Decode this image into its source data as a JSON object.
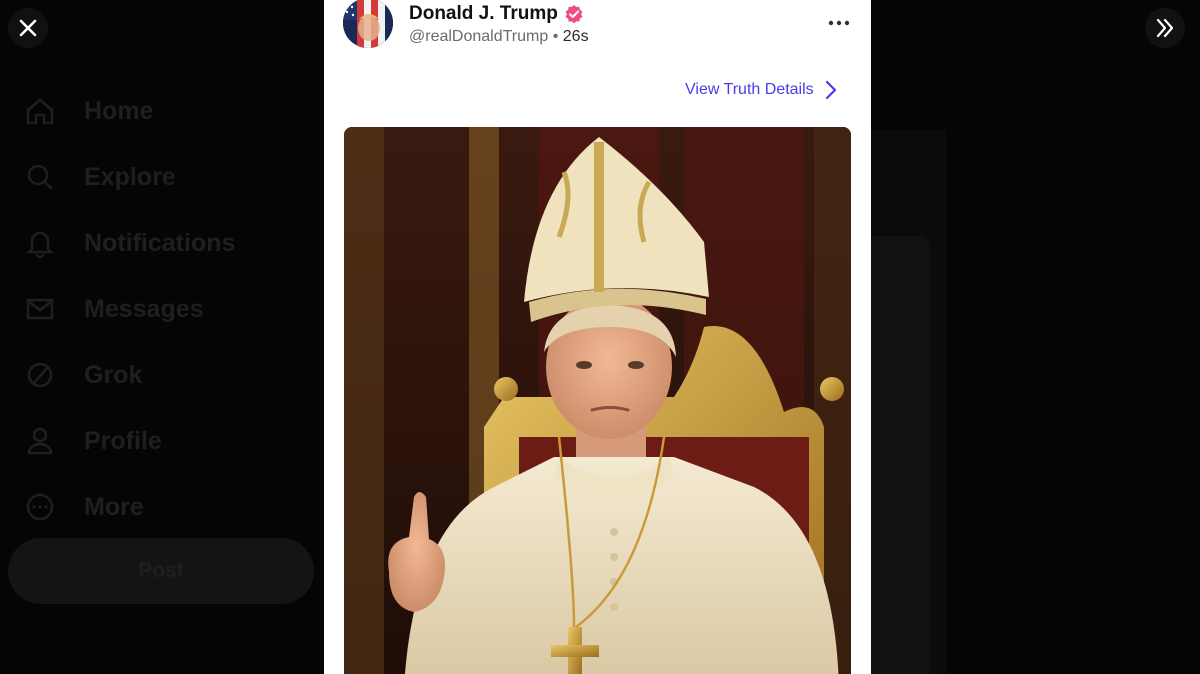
{
  "background": {
    "nav": [
      {
        "label": "Home",
        "icon": "home-icon"
      },
      {
        "label": "Explore",
        "icon": "search-icon"
      },
      {
        "label": "Notifications",
        "icon": "bell-icon"
      },
      {
        "label": "Messages",
        "icon": "mail-icon"
      },
      {
        "label": "Grok",
        "icon": "grok-icon"
      },
      {
        "label": "Profile",
        "icon": "person-icon"
      },
      {
        "label": "More",
        "icon": "more-circle-icon"
      }
    ],
    "post_label": "Post"
  },
  "overlay": {
    "close_icon": "close-icon",
    "expand_icon": "double-chevron-right-icon"
  },
  "post": {
    "author_name": "Donald J. Trump",
    "handle": "@realDonaldTrump",
    "separator": "•",
    "time": "26s",
    "view_details_label": "View Truth Details",
    "colors": {
      "link": "#4a3de6",
      "verified": "#ec4d8a"
    }
  }
}
